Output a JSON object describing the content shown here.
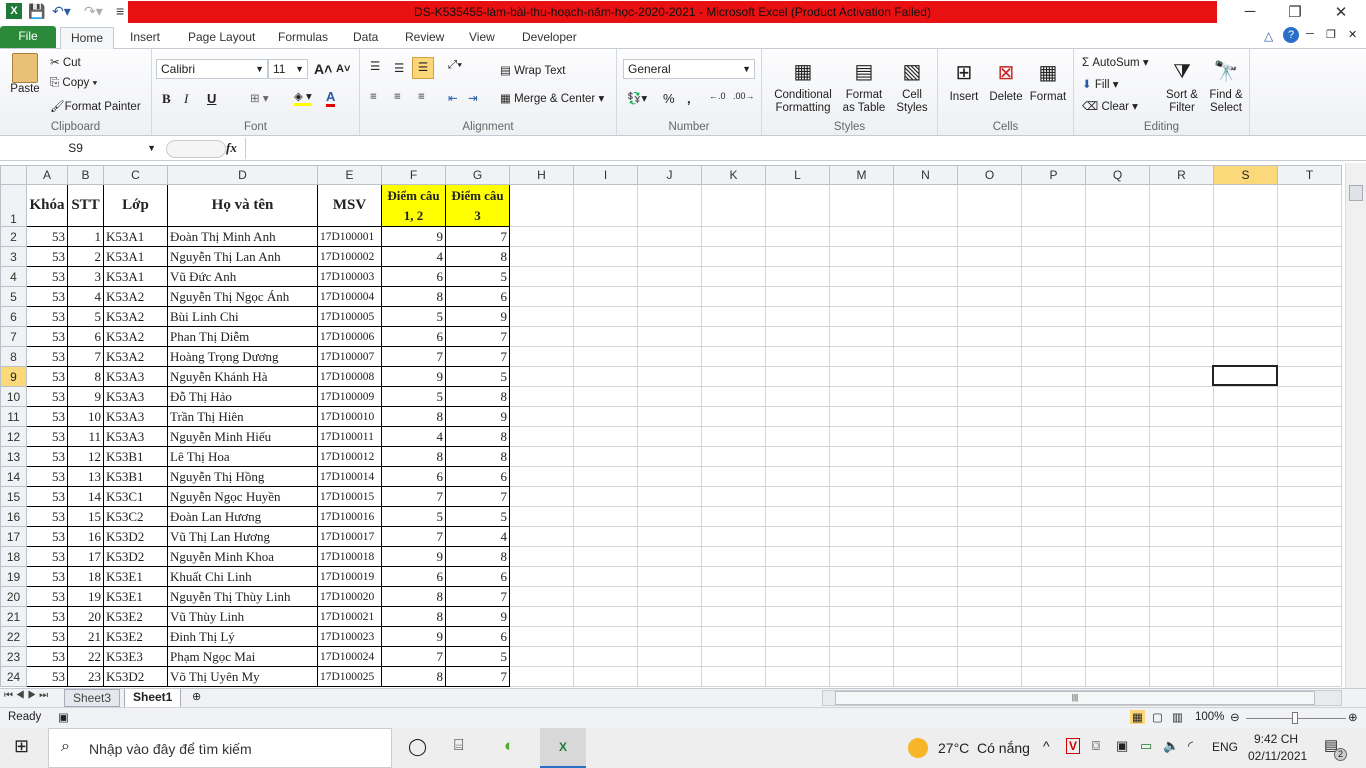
{
  "window": {
    "title": "DS-K535455-làm-bài-thu-hoạch-năm-học-2020-2021  -  Microsoft Excel (Product Activation Failed)"
  },
  "tabs": [
    "File",
    "Home",
    "Insert",
    "Page Layout",
    "Formulas",
    "Data",
    "Review",
    "View",
    "Developer"
  ],
  "ribbon": {
    "clipboard": {
      "label": "Clipboard",
      "paste": "Paste",
      "cut": "Cut",
      "copy": "Copy",
      "format_painter": "Format Painter"
    },
    "font": {
      "label": "Font",
      "name": "Calibri",
      "size": "11",
      "bold": "B",
      "italic": "I",
      "underline": "U",
      "font_color": "A"
    },
    "alignment": {
      "label": "Alignment",
      "wrap_text": "Wrap Text",
      "merge_center": "Merge & Center"
    },
    "number": {
      "label": "Number",
      "format": "General",
      "percent": "%",
      "comma": ","
    },
    "styles": {
      "label": "Styles",
      "conditional": "Conditional",
      "conditional2": "Formatting",
      "format_as": "Format",
      "format_as2": "as Table",
      "cell": "Cell",
      "cell2": "Styles"
    },
    "cells": {
      "label": "Cells",
      "insert": "Insert",
      "delete": "Delete",
      "format": "Format"
    },
    "editing": {
      "label": "Editing",
      "autosum": "AutoSum",
      "fill": "Fill",
      "clear": "Clear",
      "sort": "Sort &",
      "sort2": "Filter",
      "find": "Find &",
      "find2": "Select"
    }
  },
  "formula_bar": {
    "name_box": "S9",
    "fx": "fx",
    "value": ""
  },
  "columns": [
    "A",
    "B",
    "C",
    "D",
    "E",
    "F",
    "G",
    "H",
    "I",
    "J",
    "K",
    "L",
    "M",
    "N",
    "O",
    "P",
    "Q",
    "R",
    "S",
    "T"
  ],
  "headers": {
    "khoa": "Khóa",
    "stt": "STT",
    "lop": "Lớp",
    "name": "Họ và tên",
    "msv": "MSV",
    "diem12": "Điểm câu 1, 2",
    "diem3": "Điểm câu 3"
  },
  "rows": [
    [
      "53",
      "1",
      "K53A1",
      "Đoàn Thị Minh Anh",
      "17D100001",
      "9",
      "7"
    ],
    [
      "53",
      "2",
      "K53A1",
      "Nguyễn Thị Lan Anh",
      "17D100002",
      "4",
      "8"
    ],
    [
      "53",
      "3",
      "K53A1",
      "Vũ Đức Anh",
      "17D100003",
      "6",
      "5"
    ],
    [
      "53",
      "4",
      "K53A2",
      "Nguyễn Thị Ngọc Ánh",
      "17D100004",
      "8",
      "6"
    ],
    [
      "53",
      "5",
      "K53A2",
      "Bùi Linh Chi",
      "17D100005",
      "5",
      "9"
    ],
    [
      "53",
      "6",
      "K53A2",
      "Phan Thị Diễm",
      "17D100006",
      "6",
      "7"
    ],
    [
      "53",
      "7",
      "K53A2",
      "Hoàng Trọng Dương",
      "17D100007",
      "7",
      "7"
    ],
    [
      "53",
      "8",
      "K53A3",
      "Nguyễn Khánh Hà",
      "17D100008",
      "9",
      "5"
    ],
    [
      "53",
      "9",
      "K53A3",
      "Đỗ Thị Hảo",
      "17D100009",
      "5",
      "8"
    ],
    [
      "53",
      "10",
      "K53A3",
      "Trần Thị Hiên",
      "17D100010",
      "8",
      "9"
    ],
    [
      "53",
      "11",
      "K53A3",
      "Nguyễn Minh Hiếu",
      "17D100011",
      "4",
      "8"
    ],
    [
      "53",
      "12",
      "K53B1",
      "Lê Thị Hoa",
      "17D100012",
      "8",
      "8"
    ],
    [
      "53",
      "13",
      "K53B1",
      "Nguyễn Thị Hồng",
      "17D100014",
      "6",
      "6"
    ],
    [
      "53",
      "14",
      "K53C1",
      "Nguyễn Ngọc Huyền",
      "17D100015",
      "7",
      "7"
    ],
    [
      "53",
      "15",
      "K53C2",
      "Đoàn Lan Hương",
      "17D100016",
      "5",
      "5"
    ],
    [
      "53",
      "16",
      "K53D2",
      "Vũ Thị Lan Hương",
      "17D100017",
      "7",
      "4"
    ],
    [
      "53",
      "17",
      "K53D2",
      "Nguyễn Minh Khoa",
      "17D100018",
      "9",
      "8"
    ],
    [
      "53",
      "18",
      "K53E1",
      "Khuất Chi Linh",
      "17D100019",
      "6",
      "6"
    ],
    [
      "53",
      "19",
      "K53E1",
      "Nguyễn Thị Thùy Linh",
      "17D100020",
      "8",
      "7"
    ],
    [
      "53",
      "20",
      "K53E2",
      "Vũ Thùy Linh",
      "17D100021",
      "8",
      "9"
    ],
    [
      "53",
      "21",
      "K53E2",
      "Đinh Thị Lý",
      "17D100023",
      "9",
      "6"
    ],
    [
      "53",
      "22",
      "K53E3",
      "Phạm Ngọc Mai",
      "17D100024",
      "7",
      "5"
    ],
    [
      "53",
      "23",
      "K53D2",
      "Võ Thị Uyên My",
      "17D100025",
      "8",
      "7"
    ]
  ],
  "selected_cell": "S9",
  "sheets": [
    "Sheet3",
    "Sheet1"
  ],
  "active_sheet": "Sheet1",
  "status": {
    "mode": "Ready",
    "zoom": "100%"
  },
  "taskbar": {
    "search_placeholder": "Nhập vào đây để tìm kiếm",
    "weather_temp": "27°C",
    "weather_text": "Có nắng",
    "lang": "ENG",
    "time": "9:42 CH",
    "date": "02/11/2021",
    "notifications": "2"
  }
}
